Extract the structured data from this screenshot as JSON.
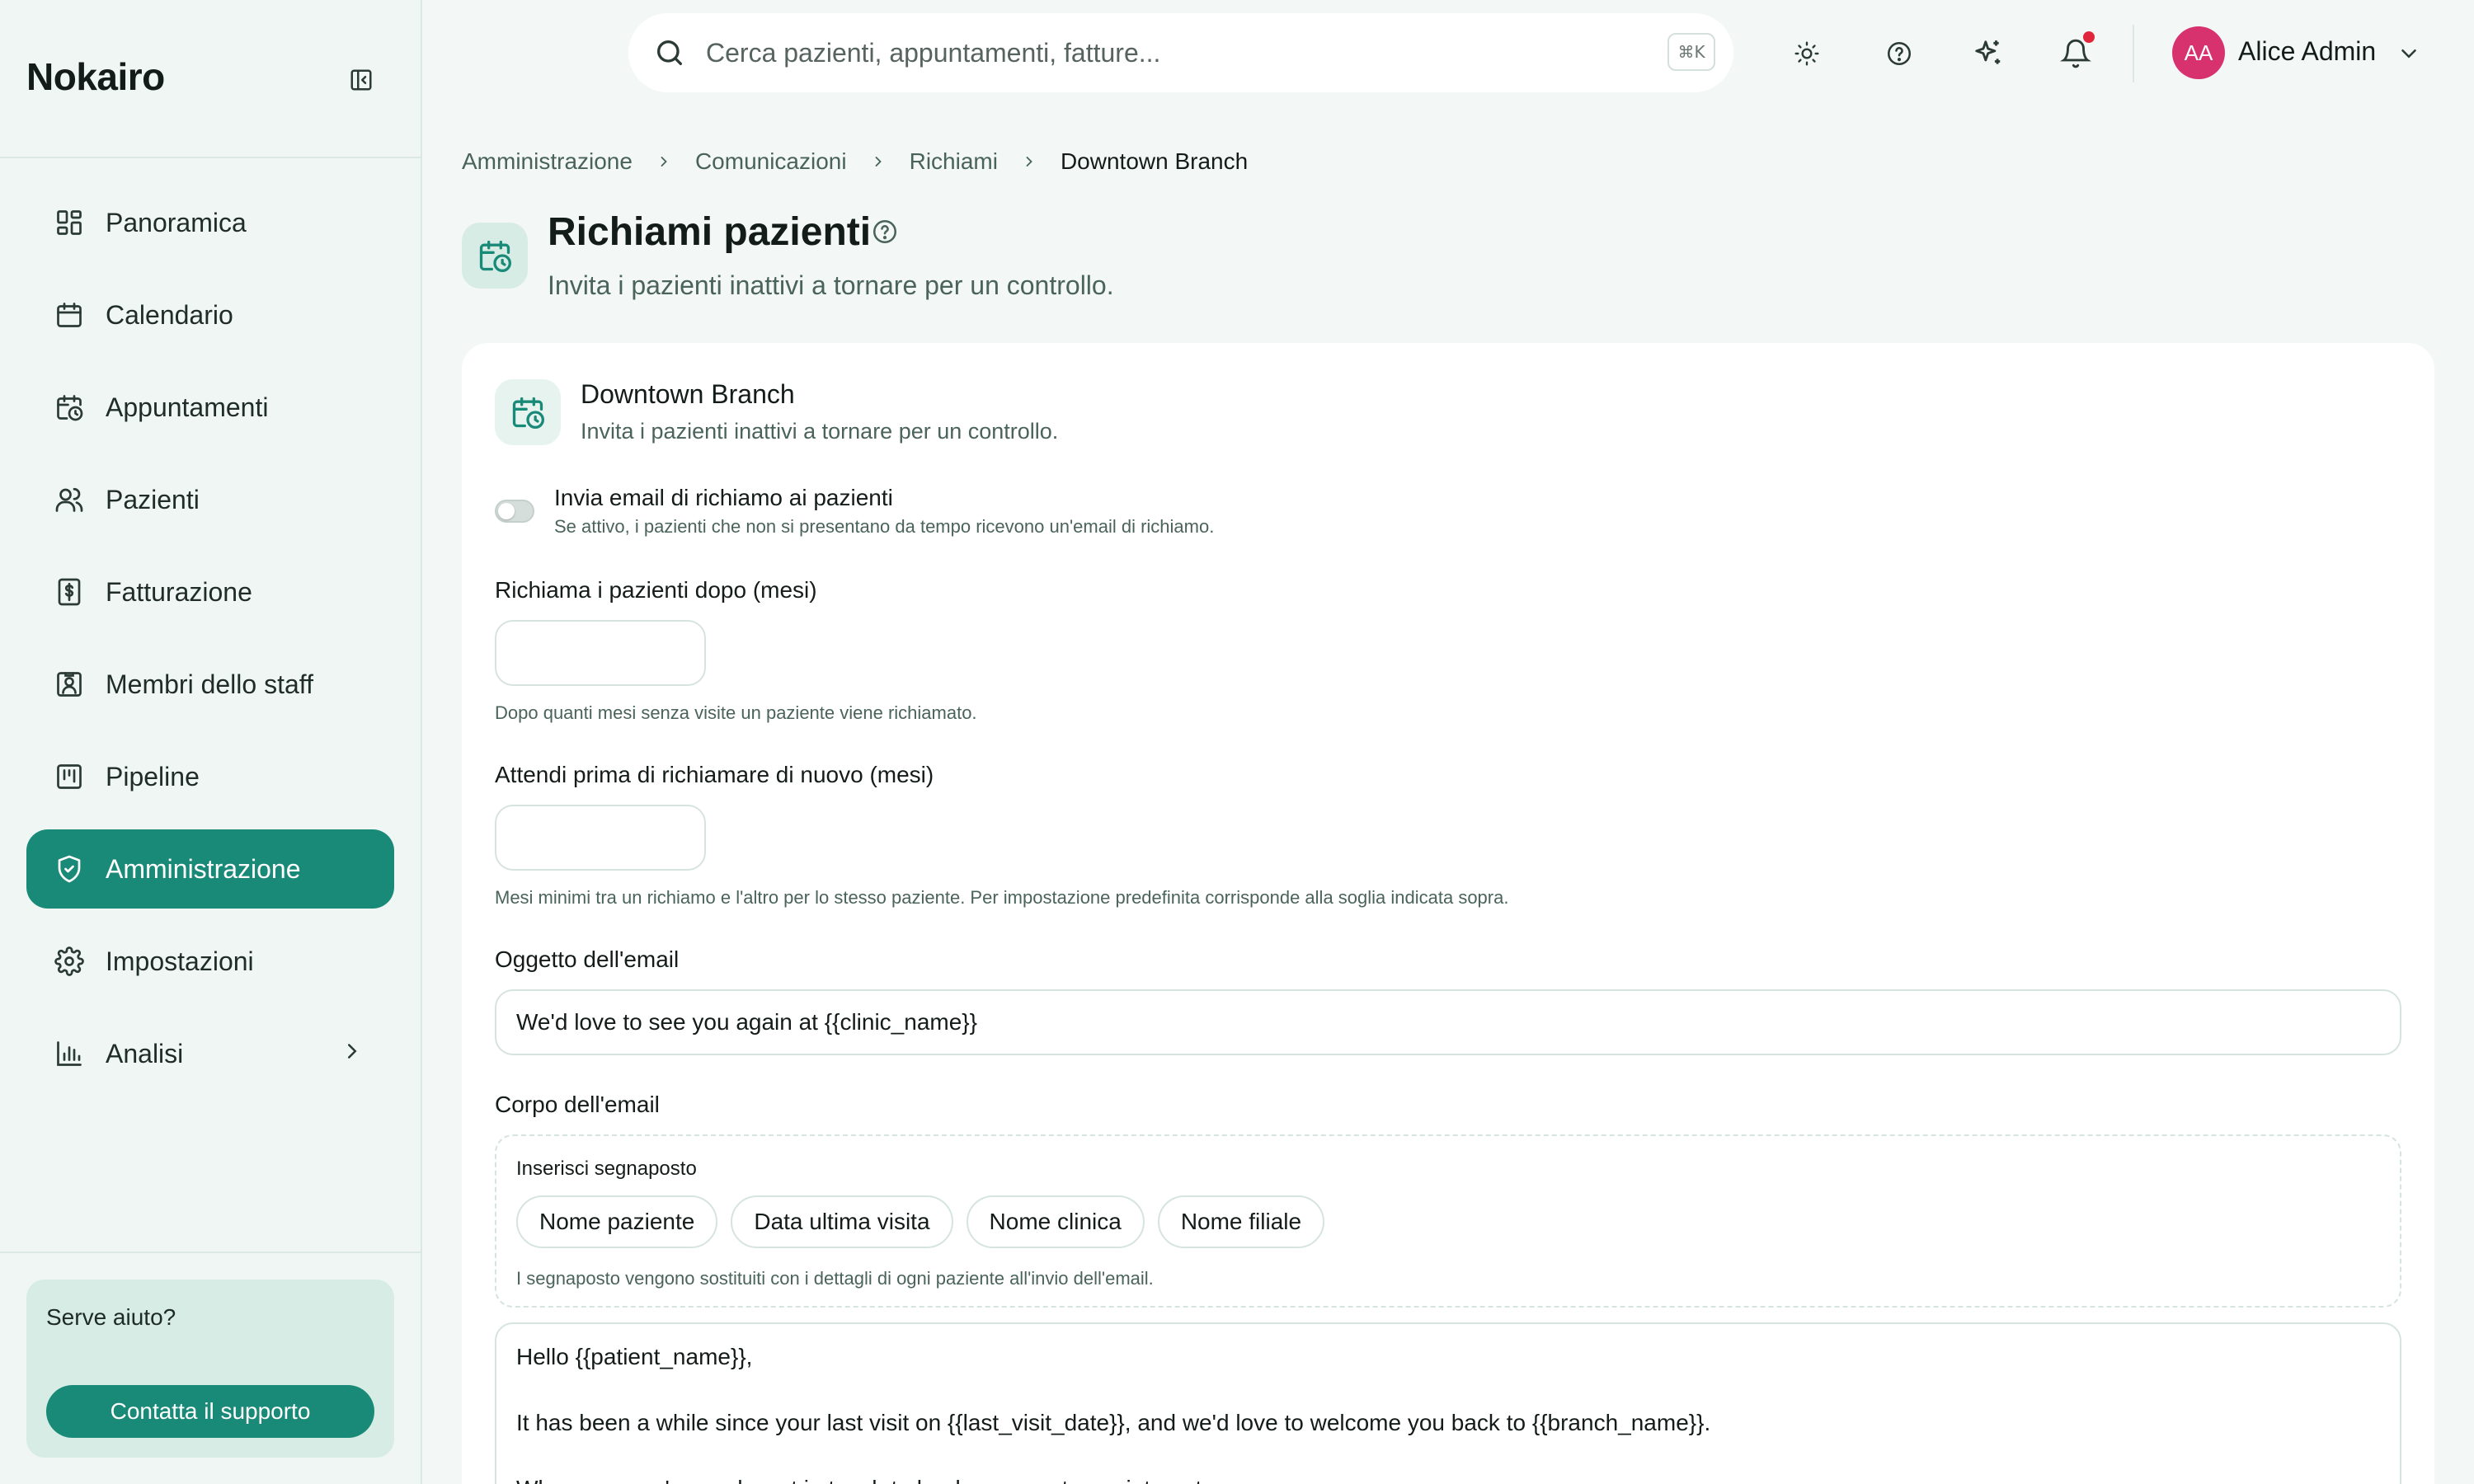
{
  "app": {
    "brand": "Nokairo"
  },
  "sidebar": {
    "items": [
      {
        "label": "Panoramica",
        "icon": "dashboard-icon",
        "active": false
      },
      {
        "label": "Calendario",
        "icon": "calendar-icon",
        "active": false
      },
      {
        "label": "Appuntamenti",
        "icon": "calendar-clock-icon",
        "active": false
      },
      {
        "label": "Pazienti",
        "icon": "users-icon",
        "active": false
      },
      {
        "label": "Fatturazione",
        "icon": "receipt-dollar-icon",
        "active": false
      },
      {
        "label": "Membri dello staff",
        "icon": "id-badge-icon",
        "active": false
      },
      {
        "label": "Pipeline",
        "icon": "kanban-icon",
        "active": false
      },
      {
        "label": "Amministrazione",
        "icon": "shield-check-icon",
        "active": true
      },
      {
        "label": "Impostazioni",
        "icon": "gear-icon",
        "active": false
      },
      {
        "label": "Analisi",
        "icon": "bar-chart-icon",
        "active": false,
        "has_submenu": true
      }
    ],
    "help": {
      "title": "Serve aiuto?",
      "button": "Contatta il supporto"
    }
  },
  "topbar": {
    "search_placeholder": "Cerca pazienti, appuntamenti, fatture...",
    "shortcut": "⌘K",
    "user": {
      "initials": "AA",
      "name": "Alice Admin"
    },
    "has_notification": true
  },
  "breadcrumb": [
    "Amministrazione",
    "Comunicazioni",
    "Richiami",
    "Downtown Branch"
  ],
  "page": {
    "title": "Richiami pazienti",
    "subtitle": "Invita i pazienti inattivi a tornare per un controllo."
  },
  "card": {
    "title": "Downtown Branch",
    "subtitle": "Invita i pazienti inattivi a tornare per un controllo.",
    "toggle": {
      "label": "Invia email di richiamo ai pazienti",
      "description": "Se attivo, i pazienti che non si presentano da tempo ricevono un'email di richiamo.",
      "enabled": false
    },
    "recall_after": {
      "label": "Richiama i pazienti dopo (mesi)",
      "value": "",
      "hint": "Dopo quanti mesi senza visite un paziente viene richiamato."
    },
    "wait_before": {
      "label": "Attendi prima di richiamare di nuovo (mesi)",
      "value": "",
      "hint": "Mesi minimi tra un richiamo e l'altro per lo stesso paziente. Per impostazione predefinita corrisponde alla soglia indicata sopra."
    },
    "subject": {
      "label": "Oggetto dell'email",
      "value": "We'd love to see you again at {{clinic_name}}"
    },
    "body": {
      "label": "Corpo dell'email",
      "placeholders_title": "Inserisci segnaposto",
      "chips": [
        "Nome paziente",
        "Data ultima visita",
        "Nome clinica",
        "Nome filiale"
      ],
      "placeholders_hint": "I segnaposto vengono sostituiti con i dettagli di ogni paziente all'invio dell'email.",
      "lines": [
        "Hello {{patient_name}},",
        "",
        "It has been a while since your last visit on {{last_visit_date}}, and we'd love to welcome you back to {{branch_name}}.",
        "",
        "Whenever you're ready, get in touch to book your next appointment."
      ]
    }
  },
  "colors": {
    "accent": "#1a8a78",
    "avatar": "#d7316e",
    "notification": "#e0263b"
  }
}
